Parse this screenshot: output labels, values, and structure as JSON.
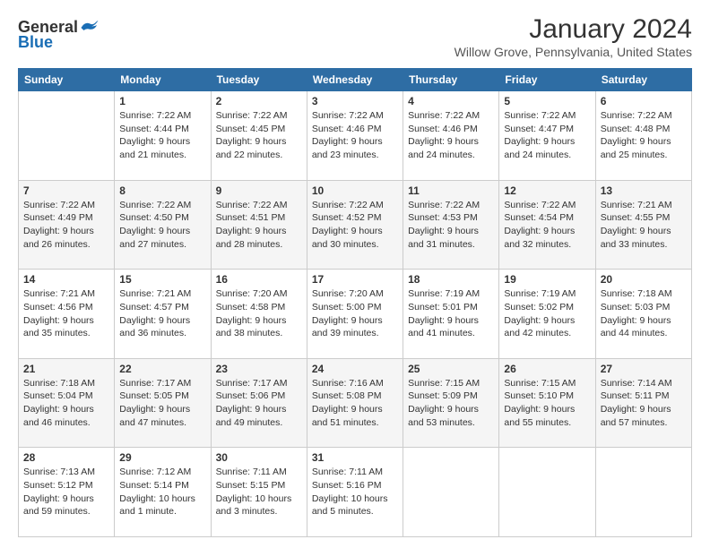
{
  "header": {
    "logo_general": "General",
    "logo_blue": "Blue",
    "title": "January 2024",
    "subtitle": "Willow Grove, Pennsylvania, United States"
  },
  "columns": [
    "Sunday",
    "Monday",
    "Tuesday",
    "Wednesday",
    "Thursday",
    "Friday",
    "Saturday"
  ],
  "weeks": [
    [
      {
        "num": "",
        "text": ""
      },
      {
        "num": "1",
        "text": "Sunrise: 7:22 AM\nSunset: 4:44 PM\nDaylight: 9 hours\nand 21 minutes."
      },
      {
        "num": "2",
        "text": "Sunrise: 7:22 AM\nSunset: 4:45 PM\nDaylight: 9 hours\nand 22 minutes."
      },
      {
        "num": "3",
        "text": "Sunrise: 7:22 AM\nSunset: 4:46 PM\nDaylight: 9 hours\nand 23 minutes."
      },
      {
        "num": "4",
        "text": "Sunrise: 7:22 AM\nSunset: 4:46 PM\nDaylight: 9 hours\nand 24 minutes."
      },
      {
        "num": "5",
        "text": "Sunrise: 7:22 AM\nSunset: 4:47 PM\nDaylight: 9 hours\nand 24 minutes."
      },
      {
        "num": "6",
        "text": "Sunrise: 7:22 AM\nSunset: 4:48 PM\nDaylight: 9 hours\nand 25 minutes."
      }
    ],
    [
      {
        "num": "7",
        "text": "Sunrise: 7:22 AM\nSunset: 4:49 PM\nDaylight: 9 hours\nand 26 minutes."
      },
      {
        "num": "8",
        "text": "Sunrise: 7:22 AM\nSunset: 4:50 PM\nDaylight: 9 hours\nand 27 minutes."
      },
      {
        "num": "9",
        "text": "Sunrise: 7:22 AM\nSunset: 4:51 PM\nDaylight: 9 hours\nand 28 minutes."
      },
      {
        "num": "10",
        "text": "Sunrise: 7:22 AM\nSunset: 4:52 PM\nDaylight: 9 hours\nand 30 minutes."
      },
      {
        "num": "11",
        "text": "Sunrise: 7:22 AM\nSunset: 4:53 PM\nDaylight: 9 hours\nand 31 minutes."
      },
      {
        "num": "12",
        "text": "Sunrise: 7:22 AM\nSunset: 4:54 PM\nDaylight: 9 hours\nand 32 minutes."
      },
      {
        "num": "13",
        "text": "Sunrise: 7:21 AM\nSunset: 4:55 PM\nDaylight: 9 hours\nand 33 minutes."
      }
    ],
    [
      {
        "num": "14",
        "text": "Sunrise: 7:21 AM\nSunset: 4:56 PM\nDaylight: 9 hours\nand 35 minutes."
      },
      {
        "num": "15",
        "text": "Sunrise: 7:21 AM\nSunset: 4:57 PM\nDaylight: 9 hours\nand 36 minutes."
      },
      {
        "num": "16",
        "text": "Sunrise: 7:20 AM\nSunset: 4:58 PM\nDaylight: 9 hours\nand 38 minutes."
      },
      {
        "num": "17",
        "text": "Sunrise: 7:20 AM\nSunset: 5:00 PM\nDaylight: 9 hours\nand 39 minutes."
      },
      {
        "num": "18",
        "text": "Sunrise: 7:19 AM\nSunset: 5:01 PM\nDaylight: 9 hours\nand 41 minutes."
      },
      {
        "num": "19",
        "text": "Sunrise: 7:19 AM\nSunset: 5:02 PM\nDaylight: 9 hours\nand 42 minutes."
      },
      {
        "num": "20",
        "text": "Sunrise: 7:18 AM\nSunset: 5:03 PM\nDaylight: 9 hours\nand 44 minutes."
      }
    ],
    [
      {
        "num": "21",
        "text": "Sunrise: 7:18 AM\nSunset: 5:04 PM\nDaylight: 9 hours\nand 46 minutes."
      },
      {
        "num": "22",
        "text": "Sunrise: 7:17 AM\nSunset: 5:05 PM\nDaylight: 9 hours\nand 47 minutes."
      },
      {
        "num": "23",
        "text": "Sunrise: 7:17 AM\nSunset: 5:06 PM\nDaylight: 9 hours\nand 49 minutes."
      },
      {
        "num": "24",
        "text": "Sunrise: 7:16 AM\nSunset: 5:08 PM\nDaylight: 9 hours\nand 51 minutes."
      },
      {
        "num": "25",
        "text": "Sunrise: 7:15 AM\nSunset: 5:09 PM\nDaylight: 9 hours\nand 53 minutes."
      },
      {
        "num": "26",
        "text": "Sunrise: 7:15 AM\nSunset: 5:10 PM\nDaylight: 9 hours\nand 55 minutes."
      },
      {
        "num": "27",
        "text": "Sunrise: 7:14 AM\nSunset: 5:11 PM\nDaylight: 9 hours\nand 57 minutes."
      }
    ],
    [
      {
        "num": "28",
        "text": "Sunrise: 7:13 AM\nSunset: 5:12 PM\nDaylight: 9 hours\nand 59 minutes."
      },
      {
        "num": "29",
        "text": "Sunrise: 7:12 AM\nSunset: 5:14 PM\nDaylight: 10 hours\nand 1 minute."
      },
      {
        "num": "30",
        "text": "Sunrise: 7:11 AM\nSunset: 5:15 PM\nDaylight: 10 hours\nand 3 minutes."
      },
      {
        "num": "31",
        "text": "Sunrise: 7:11 AM\nSunset: 5:16 PM\nDaylight: 10 hours\nand 5 minutes."
      },
      {
        "num": "",
        "text": ""
      },
      {
        "num": "",
        "text": ""
      },
      {
        "num": "",
        "text": ""
      }
    ]
  ]
}
